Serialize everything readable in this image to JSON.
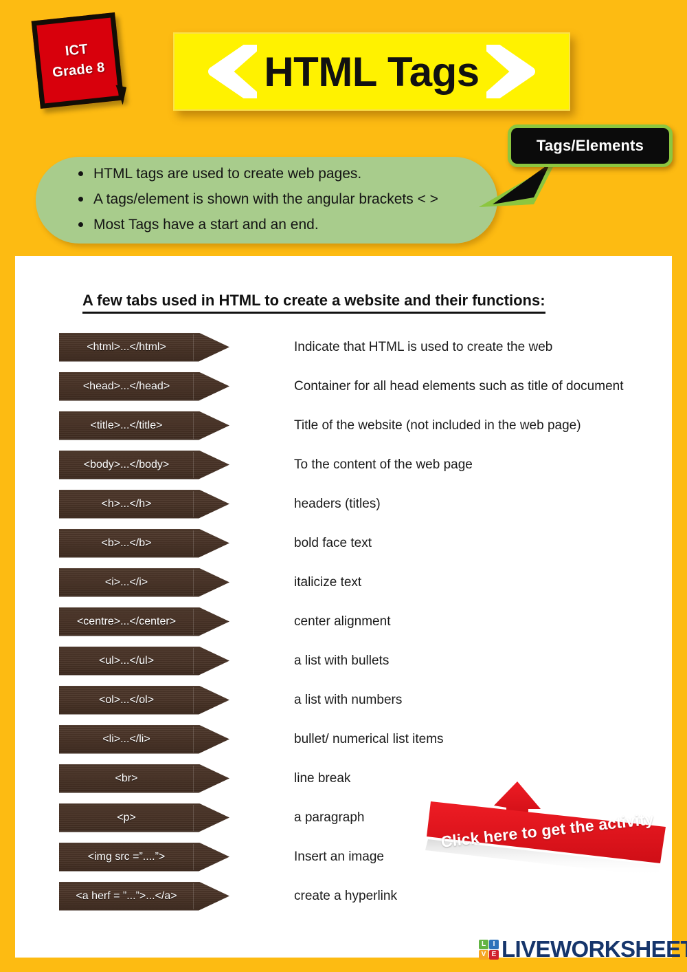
{
  "header": {
    "grade_badge": {
      "line1": "ICT",
      "line2": "Grade 8"
    },
    "title": "HTML Tags",
    "chevron_left_icon": "chevron-left-icon",
    "chevron_right_icon": "chevron-right-icon"
  },
  "callout": {
    "label": "Tags/Elements"
  },
  "info_bubble": {
    "bullets": [
      "HTML tags are used to create web pages.",
      "A tags/element is shown with the angular brackets < >",
      "Most Tags have a start and an end."
    ]
  },
  "sheet": {
    "heading": "A few tabs used in HTML to create a website and their functions:",
    "rows": [
      {
        "tag": "<html>...</html>",
        "description": "Indicate that HTML is used to create the web"
      },
      {
        "tag": "<head>...</head>",
        "description": "Container for all head elements such as title of document"
      },
      {
        "tag": "<title>...</title>",
        "description": "Title of the website (not included in the web page)"
      },
      {
        "tag": "<body>...</body>",
        "description": "To the content of the web page"
      },
      {
        "tag": "<h>...</h>",
        "description": "headers (titles)"
      },
      {
        "tag": "<b>...</b>",
        "description": "bold face text"
      },
      {
        "tag": "<i>...</i>",
        "description": "italicize text"
      },
      {
        "tag": "<centre>...</center>",
        "description": "center alignment"
      },
      {
        "tag": "<ul>...</ul>",
        "description": "a list with bullets"
      },
      {
        "tag": "<ol>...</ol>",
        "description": "a list with numbers"
      },
      {
        "tag": "<li>...</li>",
        "description": "bullet/ numerical list items"
      },
      {
        "tag": "<br>",
        "description": "line break"
      },
      {
        "tag": "<p>",
        "description": "a paragraph"
      },
      {
        "tag": "<img src =”....”>",
        "description": "Insert an image"
      },
      {
        "tag": "<a herf = ”...”>...</a>",
        "description": "create a hyperlink"
      }
    ]
  },
  "cta": {
    "label": "Click here to get the activity",
    "arrow_icon": "arrow-up-icon"
  },
  "footer": {
    "logo_letters": [
      "L",
      "I",
      "V",
      "E"
    ],
    "logo_text": "LIVEWORKSHEETS"
  },
  "colors": {
    "page_background": "#FDBB12",
    "banner_yellow": "#FFF200",
    "badge_red": "#D8000C",
    "bubble_green": "#A8CC8C",
    "callout_border_green": "#8CC63F",
    "tag_brown": "#4A3428",
    "cta_red": "#E1141B",
    "logo_navy": "#16356B"
  }
}
